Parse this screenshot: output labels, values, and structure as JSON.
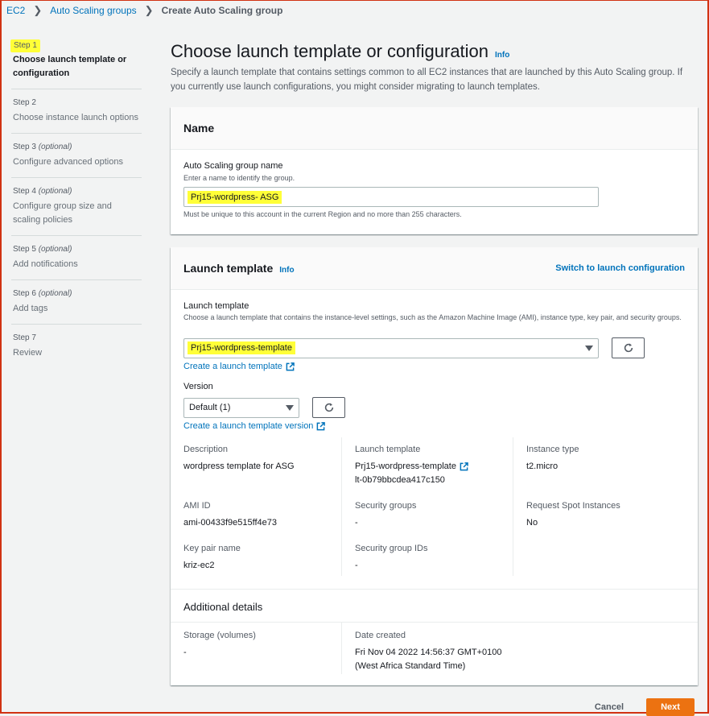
{
  "breadcrumb": {
    "items": [
      "EC2",
      "Auto Scaling groups"
    ],
    "current": "Create Auto Scaling group"
  },
  "steps": [
    {
      "num": "Step 1",
      "optional": "",
      "title": "Choose launch template or configuration"
    },
    {
      "num": "Step 2",
      "optional": "",
      "title": "Choose instance launch options"
    },
    {
      "num": "Step 3",
      "optional": "(optional)",
      "title": "Configure advanced options"
    },
    {
      "num": "Step 4",
      "optional": "(optional)",
      "title": "Configure group size and scaling policies"
    },
    {
      "num": "Step 5",
      "optional": "(optional)",
      "title": "Add notifications"
    },
    {
      "num": "Step 6",
      "optional": "(optional)",
      "title": "Add tags"
    },
    {
      "num": "Step 7",
      "optional": "",
      "title": "Review"
    }
  ],
  "page": {
    "title": "Choose launch template or configuration",
    "info": "Info",
    "description": "Specify a launch template that contains settings common to all EC2 instances that are launched by this Auto Scaling group. If you currently use launch configurations, you might consider migrating to launch templates."
  },
  "name_panel": {
    "header": "Name",
    "label": "Auto Scaling group name",
    "hint": "Enter a name to identify the group.",
    "value": "Prj15-wordpress- ASG",
    "constraint": "Must be unique to this account in the current Region and no more than 255 characters."
  },
  "lt_panel": {
    "header": "Launch template",
    "info": "Info",
    "switch_link": "Switch to launch configuration",
    "label": "Launch template",
    "hint": "Choose a launch template that contains the instance-level settings, such as the Amazon Machine Image (AMI), instance type, key pair, and security groups.",
    "selected": "Prj15-wordpress-template",
    "create_link": "Create a launch template",
    "version_label": "Version",
    "version_selected": "Default (1)",
    "create_version_link": "Create a launch template version",
    "details": {
      "description_k": "Description",
      "description_v": "wordpress template for ASG",
      "lt_k": "Launch template",
      "lt_name": "Prj15-wordpress-template",
      "lt_id": "lt-0b79bbcdea417c150",
      "instance_type_k": "Instance type",
      "instance_type_v": "t2.micro",
      "ami_k": "AMI ID",
      "ami_v": "ami-00433f9e515ff4e73",
      "sg_k": "Security groups",
      "sg_v": "-",
      "spot_k": "Request Spot Instances",
      "spot_v": "No",
      "key_k": "Key pair name",
      "key_v": "kriz-ec2",
      "sgid_k": "Security group IDs",
      "sgid_v": "-"
    },
    "additional": {
      "header": "Additional details",
      "storage_k": "Storage (volumes)",
      "storage_v": "-",
      "date_k": "Date created",
      "date_v1": "Fri Nov 04 2022 14:56:37 GMT+0100",
      "date_v2": "(West Africa Standard Time)"
    }
  },
  "footer": {
    "cancel": "Cancel",
    "next": "Next"
  },
  "colors": {
    "link": "#0073bb",
    "primary": "#ec7211",
    "highlight": "#ffff38"
  }
}
